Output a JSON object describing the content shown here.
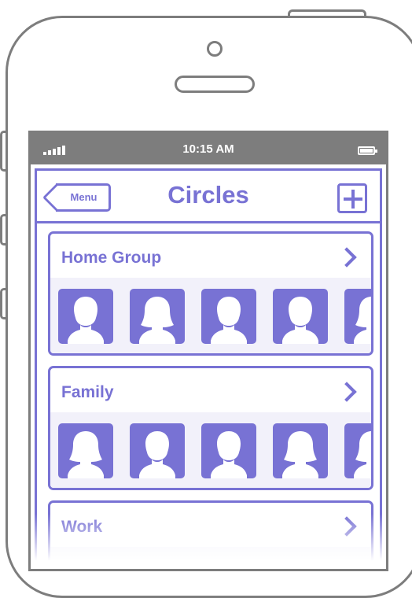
{
  "status_bar": {
    "time": "10:15 AM",
    "signal_icon": "signal-bars-icon",
    "battery_icon": "battery-icon"
  },
  "nav": {
    "back_label": "Menu",
    "title": "Circles",
    "add_icon": "plus-icon"
  },
  "circles": [
    {
      "name": "Home Group",
      "members": [
        "male",
        "female",
        "male",
        "male",
        "female"
      ]
    },
    {
      "name": "Family",
      "members": [
        "female",
        "male",
        "male",
        "female",
        "female"
      ]
    },
    {
      "name": "Work",
      "members": []
    }
  ],
  "colors": {
    "accent": "#7872d4",
    "frame": "#7d7d7d",
    "card_strip": "#f2f1fa"
  }
}
